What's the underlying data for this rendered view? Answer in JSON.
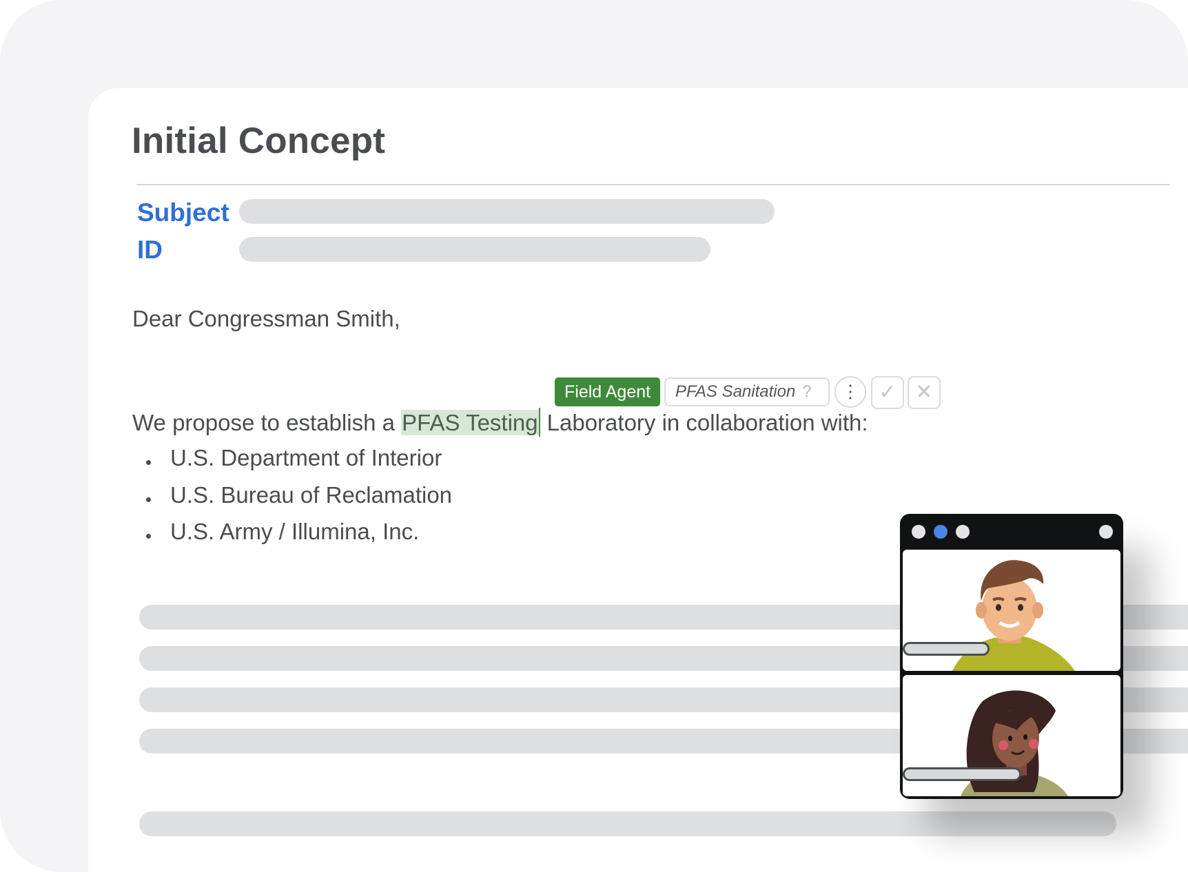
{
  "document": {
    "title": "Initial Concept",
    "subject_label": "Subject",
    "id_label": "ID",
    "greeting": "Dear Congressman Smith,",
    "sentence_before": "We propose to establish a ",
    "highlighted_term": "PFAS Testing",
    "sentence_after": "Laboratory in collaboration with:",
    "collaborators": [
      "U.S. Department of Interior",
      "U.S. Bureau of Reclamation",
      "U.S. Army / Illumina, Inc."
    ]
  },
  "annotation": {
    "tag_label": "Field Agent",
    "suggestion": "PFAS Sanitation",
    "help_glyph": "?",
    "more_glyph": "⋮",
    "accept_glyph": "✓",
    "reject_glyph": "✕",
    "icons": [
      "more-options-icon",
      "checkmark-icon",
      "close-icon"
    ]
  },
  "video_call": {
    "window_controls": [
      "gray",
      "blue",
      "gray"
    ],
    "participants": [
      "man-avatar",
      "woman-avatar"
    ]
  },
  "colors": {
    "accent_blue": "#2f6fd6",
    "tag_green": "#3f8a3a",
    "highlight_green": "#d9e8d6",
    "placeholder_gray": "#dedfe1"
  }
}
